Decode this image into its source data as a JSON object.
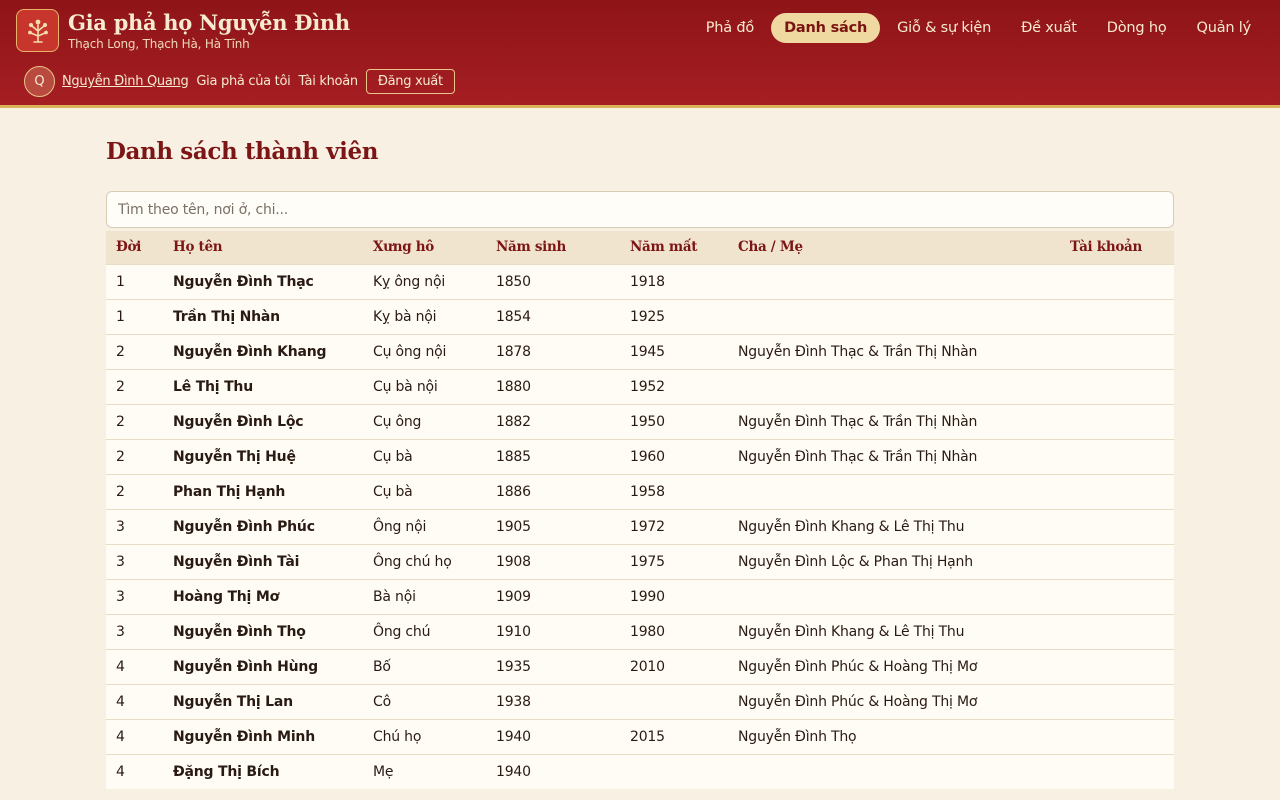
{
  "brand": {
    "title": "Gia phả họ Nguyễn Đình",
    "subtitle": "Thạch Long, Thạch Hà, Hà Tĩnh",
    "logo_icon": "family-tree-icon"
  },
  "nav": {
    "items": [
      "Phả đồ",
      "Danh sách",
      "Giỗ & sự kiện",
      "Đề xuất",
      "Dòng họ",
      "Quản lý"
    ],
    "active": "Danh sách"
  },
  "user": {
    "initial": "Q",
    "name": "Nguyễn Đình Quang",
    "my_tree": "Gia phả của tôi",
    "account": "Tài khoản",
    "logout": "Đăng xuất"
  },
  "page": {
    "title": "Danh sách thành viên",
    "search_placeholder": "Tìm theo tên, nơi ở, chi..."
  },
  "table": {
    "headers": [
      "Đời",
      "Họ tên",
      "Xưng hô",
      "Năm sinh",
      "Năm mất",
      "Cha / Mẹ",
      "Tài khoản"
    ],
    "rows": [
      [
        "1",
        "Nguyễn Đình Thạc",
        "Kỵ ông nội",
        "1850",
        "1918",
        "",
        ""
      ],
      [
        "1",
        "Trần Thị Nhàn",
        "Kỵ bà nội",
        "1854",
        "1925",
        "",
        ""
      ],
      [
        "2",
        "Nguyễn Đình Khang",
        "Cụ ông nội",
        "1878",
        "1945",
        "Nguyễn Đình Thạc & Trần Thị Nhàn",
        ""
      ],
      [
        "2",
        "Lê Thị Thu",
        "Cụ bà nội",
        "1880",
        "1952",
        "",
        ""
      ],
      [
        "2",
        "Nguyễn Đình Lộc",
        "Cụ ông",
        "1882",
        "1950",
        "Nguyễn Đình Thạc & Trần Thị Nhàn",
        ""
      ],
      [
        "2",
        "Nguyễn Thị Huệ",
        "Cụ bà",
        "1885",
        "1960",
        "Nguyễn Đình Thạc & Trần Thị Nhàn",
        ""
      ],
      [
        "2",
        "Phan Thị Hạnh",
        "Cụ bà",
        "1886",
        "1958",
        "",
        ""
      ],
      [
        "3",
        "Nguyễn Đình Phúc",
        "Ông nội",
        "1905",
        "1972",
        "Nguyễn Đình Khang & Lê Thị Thu",
        ""
      ],
      [
        "3",
        "Nguyễn Đình Tài",
        "Ông chú họ",
        "1908",
        "1975",
        "Nguyễn Đình Lộc & Phan Thị Hạnh",
        ""
      ],
      [
        "3",
        "Hoàng Thị Mơ",
        "Bà nội",
        "1909",
        "1990",
        "",
        ""
      ],
      [
        "3",
        "Nguyễn Đình Thọ",
        "Ông chú",
        "1910",
        "1980",
        "Nguyễn Đình Khang & Lê Thị Thu",
        ""
      ],
      [
        "4",
        "Nguyễn Đình Hùng",
        "Bố",
        "1935",
        "2010",
        "Nguyễn Đình Phúc & Hoàng Thị Mơ",
        ""
      ],
      [
        "4",
        "Nguyễn Thị Lan",
        "Cô",
        "1938",
        "",
        "Nguyễn Đình Phúc & Hoàng Thị Mơ",
        ""
      ],
      [
        "4",
        "Nguyễn Đình Minh",
        "Chú họ",
        "1940",
        "2015",
        "Nguyễn Đình Thọ",
        ""
      ],
      [
        "4",
        "Đặng Thị Bích",
        "Mẹ",
        "1940",
        "",
        "",
        ""
      ]
    ]
  },
  "colors": {
    "header_bg": "#9a181c",
    "accent_gold": "#d9b25a",
    "title_red": "#7c1616",
    "page_bg": "#f8f0e2"
  }
}
